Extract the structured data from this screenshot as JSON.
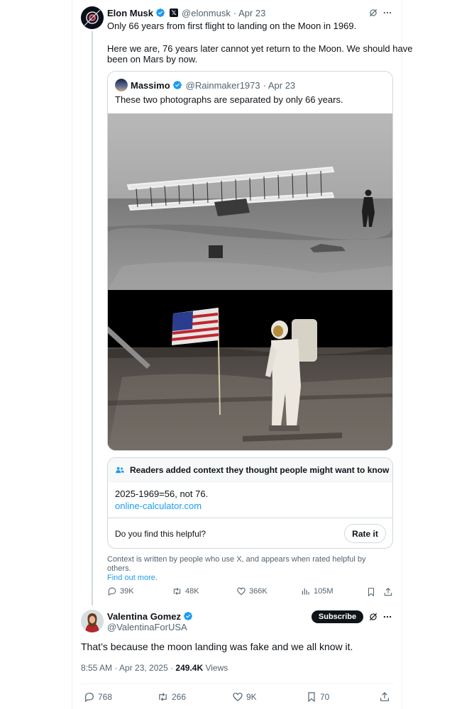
{
  "tweet": {
    "author_name": "Elon Musk",
    "handle": "@elonmusk",
    "date": "· Apr 23",
    "text_line1": "Only 66 years from first flight to landing on the Moon in 1969.",
    "text_line2": "Here we are, 76 years later cannot yet return to the Moon. We should have",
    "text_line3": "been on Mars by now."
  },
  "quote": {
    "author_name": "Massimo",
    "handle": "@Rainmaker1973",
    "date": "· Apr 23",
    "text": "These two photographs are separated by only 66 years."
  },
  "community_note": {
    "header": "Readers added context they thought people might want to know",
    "body": "2025-1969=56, not 76.",
    "link": "online-calculator.com",
    "question": "Do you find this helpful?",
    "rate_label": "Rate it",
    "footnote": "Context is written by people who use X, and appears when rated helpful by others.",
    "footnote_link": "Find out more",
    "footnote_period": "."
  },
  "tweet_actions": {
    "replies": "39K",
    "reposts": "48K",
    "likes": "366K",
    "views": "105M"
  },
  "reply": {
    "author_name": "Valentina Gomez",
    "handle": "@ValentinaForUSA",
    "subscribe_label": "Subscribe",
    "text": "That’s because the moon landing was fake and we all know it.",
    "time": "8:55 AM · Apr 23, 2025 · ",
    "views_count": "249.4K",
    "views_label": " Views"
  },
  "reply_actions": {
    "replies": "768",
    "reposts": "266",
    "likes": "9K",
    "bookmarks": "70"
  },
  "colors": {
    "accent": "#1d9bf0",
    "text": "#0f1419",
    "muted": "#536471",
    "border": "#cfd9de"
  }
}
